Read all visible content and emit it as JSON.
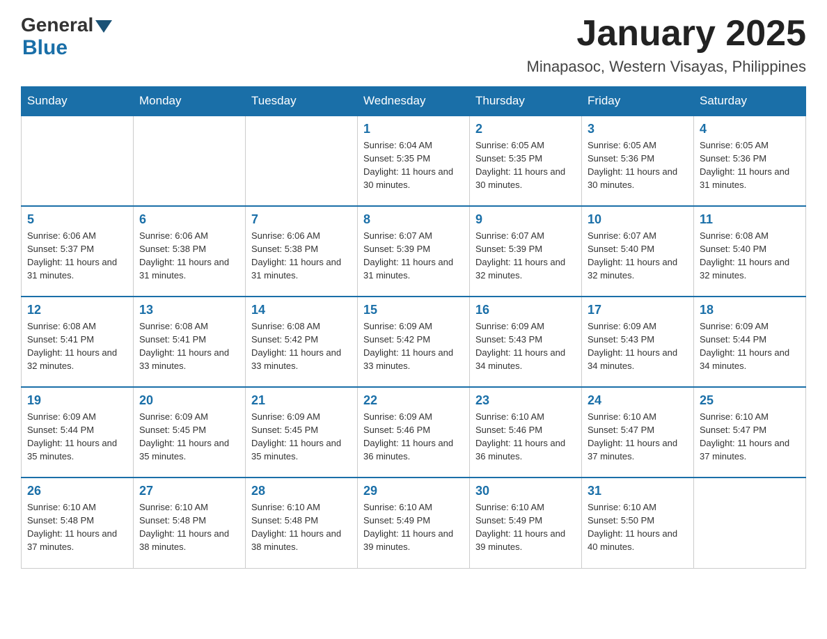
{
  "header": {
    "logo": {
      "general": "General",
      "blue": "Blue"
    },
    "title": "January 2025",
    "subtitle": "Minapasoc, Western Visayas, Philippines"
  },
  "days_of_week": [
    "Sunday",
    "Monday",
    "Tuesday",
    "Wednesday",
    "Thursday",
    "Friday",
    "Saturday"
  ],
  "weeks": [
    {
      "days": [
        {
          "number": "",
          "info": ""
        },
        {
          "number": "",
          "info": ""
        },
        {
          "number": "",
          "info": ""
        },
        {
          "number": "1",
          "info": "Sunrise: 6:04 AM\nSunset: 5:35 PM\nDaylight: 11 hours and 30 minutes."
        },
        {
          "number": "2",
          "info": "Sunrise: 6:05 AM\nSunset: 5:35 PM\nDaylight: 11 hours and 30 minutes."
        },
        {
          "number": "3",
          "info": "Sunrise: 6:05 AM\nSunset: 5:36 PM\nDaylight: 11 hours and 30 minutes."
        },
        {
          "number": "4",
          "info": "Sunrise: 6:05 AM\nSunset: 5:36 PM\nDaylight: 11 hours and 31 minutes."
        }
      ]
    },
    {
      "days": [
        {
          "number": "5",
          "info": "Sunrise: 6:06 AM\nSunset: 5:37 PM\nDaylight: 11 hours and 31 minutes."
        },
        {
          "number": "6",
          "info": "Sunrise: 6:06 AM\nSunset: 5:38 PM\nDaylight: 11 hours and 31 minutes."
        },
        {
          "number": "7",
          "info": "Sunrise: 6:06 AM\nSunset: 5:38 PM\nDaylight: 11 hours and 31 minutes."
        },
        {
          "number": "8",
          "info": "Sunrise: 6:07 AM\nSunset: 5:39 PM\nDaylight: 11 hours and 31 minutes."
        },
        {
          "number": "9",
          "info": "Sunrise: 6:07 AM\nSunset: 5:39 PM\nDaylight: 11 hours and 32 minutes."
        },
        {
          "number": "10",
          "info": "Sunrise: 6:07 AM\nSunset: 5:40 PM\nDaylight: 11 hours and 32 minutes."
        },
        {
          "number": "11",
          "info": "Sunrise: 6:08 AM\nSunset: 5:40 PM\nDaylight: 11 hours and 32 minutes."
        }
      ]
    },
    {
      "days": [
        {
          "number": "12",
          "info": "Sunrise: 6:08 AM\nSunset: 5:41 PM\nDaylight: 11 hours and 32 minutes."
        },
        {
          "number": "13",
          "info": "Sunrise: 6:08 AM\nSunset: 5:41 PM\nDaylight: 11 hours and 33 minutes."
        },
        {
          "number": "14",
          "info": "Sunrise: 6:08 AM\nSunset: 5:42 PM\nDaylight: 11 hours and 33 minutes."
        },
        {
          "number": "15",
          "info": "Sunrise: 6:09 AM\nSunset: 5:42 PM\nDaylight: 11 hours and 33 minutes."
        },
        {
          "number": "16",
          "info": "Sunrise: 6:09 AM\nSunset: 5:43 PM\nDaylight: 11 hours and 34 minutes."
        },
        {
          "number": "17",
          "info": "Sunrise: 6:09 AM\nSunset: 5:43 PM\nDaylight: 11 hours and 34 minutes."
        },
        {
          "number": "18",
          "info": "Sunrise: 6:09 AM\nSunset: 5:44 PM\nDaylight: 11 hours and 34 minutes."
        }
      ]
    },
    {
      "days": [
        {
          "number": "19",
          "info": "Sunrise: 6:09 AM\nSunset: 5:44 PM\nDaylight: 11 hours and 35 minutes."
        },
        {
          "number": "20",
          "info": "Sunrise: 6:09 AM\nSunset: 5:45 PM\nDaylight: 11 hours and 35 minutes."
        },
        {
          "number": "21",
          "info": "Sunrise: 6:09 AM\nSunset: 5:45 PM\nDaylight: 11 hours and 35 minutes."
        },
        {
          "number": "22",
          "info": "Sunrise: 6:09 AM\nSunset: 5:46 PM\nDaylight: 11 hours and 36 minutes."
        },
        {
          "number": "23",
          "info": "Sunrise: 6:10 AM\nSunset: 5:46 PM\nDaylight: 11 hours and 36 minutes."
        },
        {
          "number": "24",
          "info": "Sunrise: 6:10 AM\nSunset: 5:47 PM\nDaylight: 11 hours and 37 minutes."
        },
        {
          "number": "25",
          "info": "Sunrise: 6:10 AM\nSunset: 5:47 PM\nDaylight: 11 hours and 37 minutes."
        }
      ]
    },
    {
      "days": [
        {
          "number": "26",
          "info": "Sunrise: 6:10 AM\nSunset: 5:48 PM\nDaylight: 11 hours and 37 minutes."
        },
        {
          "number": "27",
          "info": "Sunrise: 6:10 AM\nSunset: 5:48 PM\nDaylight: 11 hours and 38 minutes."
        },
        {
          "number": "28",
          "info": "Sunrise: 6:10 AM\nSunset: 5:48 PM\nDaylight: 11 hours and 38 minutes."
        },
        {
          "number": "29",
          "info": "Sunrise: 6:10 AM\nSunset: 5:49 PM\nDaylight: 11 hours and 39 minutes."
        },
        {
          "number": "30",
          "info": "Sunrise: 6:10 AM\nSunset: 5:49 PM\nDaylight: 11 hours and 39 minutes."
        },
        {
          "number": "31",
          "info": "Sunrise: 6:10 AM\nSunset: 5:50 PM\nDaylight: 11 hours and 40 minutes."
        },
        {
          "number": "",
          "info": ""
        }
      ]
    }
  ]
}
